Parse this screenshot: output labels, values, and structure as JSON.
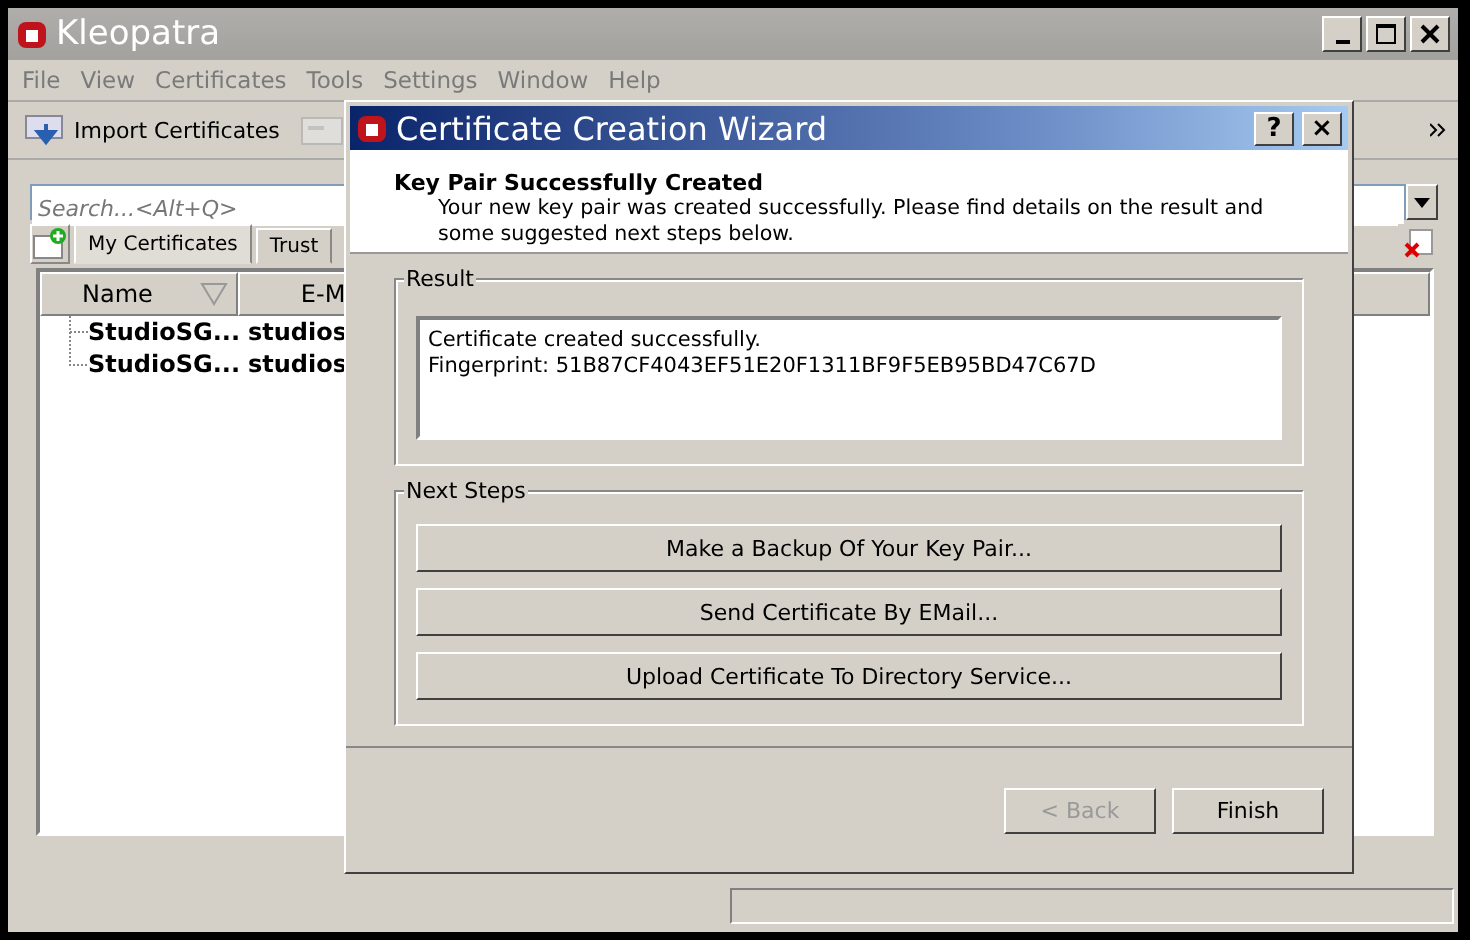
{
  "window": {
    "title": "Kleopatra"
  },
  "menu": [
    "File",
    "View",
    "Certificates",
    "Tools",
    "Settings",
    "Window",
    "Help"
  ],
  "toolbar": {
    "items": [
      {
        "label": "Import Certificates"
      }
    ]
  },
  "search": {
    "placeholder": "Search...<Alt+Q>"
  },
  "tabs": [
    {
      "label": "My Certificates",
      "selected": true
    },
    {
      "label": "Trust",
      "selected": false
    }
  ],
  "table": {
    "columns": [
      "Name",
      "E-M"
    ],
    "rows": [
      {
        "cells": [
          "StudioSG...",
          "studios"
        ]
      },
      {
        "cells": [
          "StudioSG...",
          "studios"
        ]
      }
    ]
  },
  "dialog": {
    "title": "Certificate Creation Wizard",
    "help_button": "?",
    "close_button": "×",
    "heading": "Key Pair Successfully Created",
    "subheading": "Your new key pair was created successfully. Please find details on the result and some suggested next steps below.",
    "result": {
      "label": "Result",
      "lines": [
        "Certificate created successfully.",
        "Fingerprint: 51B87CF4043EF51E20F1311BF9F5EB95BD47C67D"
      ]
    },
    "next_steps": {
      "label": "Next Steps",
      "buttons": [
        "Make a Backup Of Your Key Pair...",
        "Send Certificate By EMail...",
        "Upload Certificate To Directory Service..."
      ]
    },
    "buttons": [
      {
        "label": "< Back",
        "disabled": true
      },
      {
        "label": "Finish",
        "disabled": false
      }
    ]
  }
}
